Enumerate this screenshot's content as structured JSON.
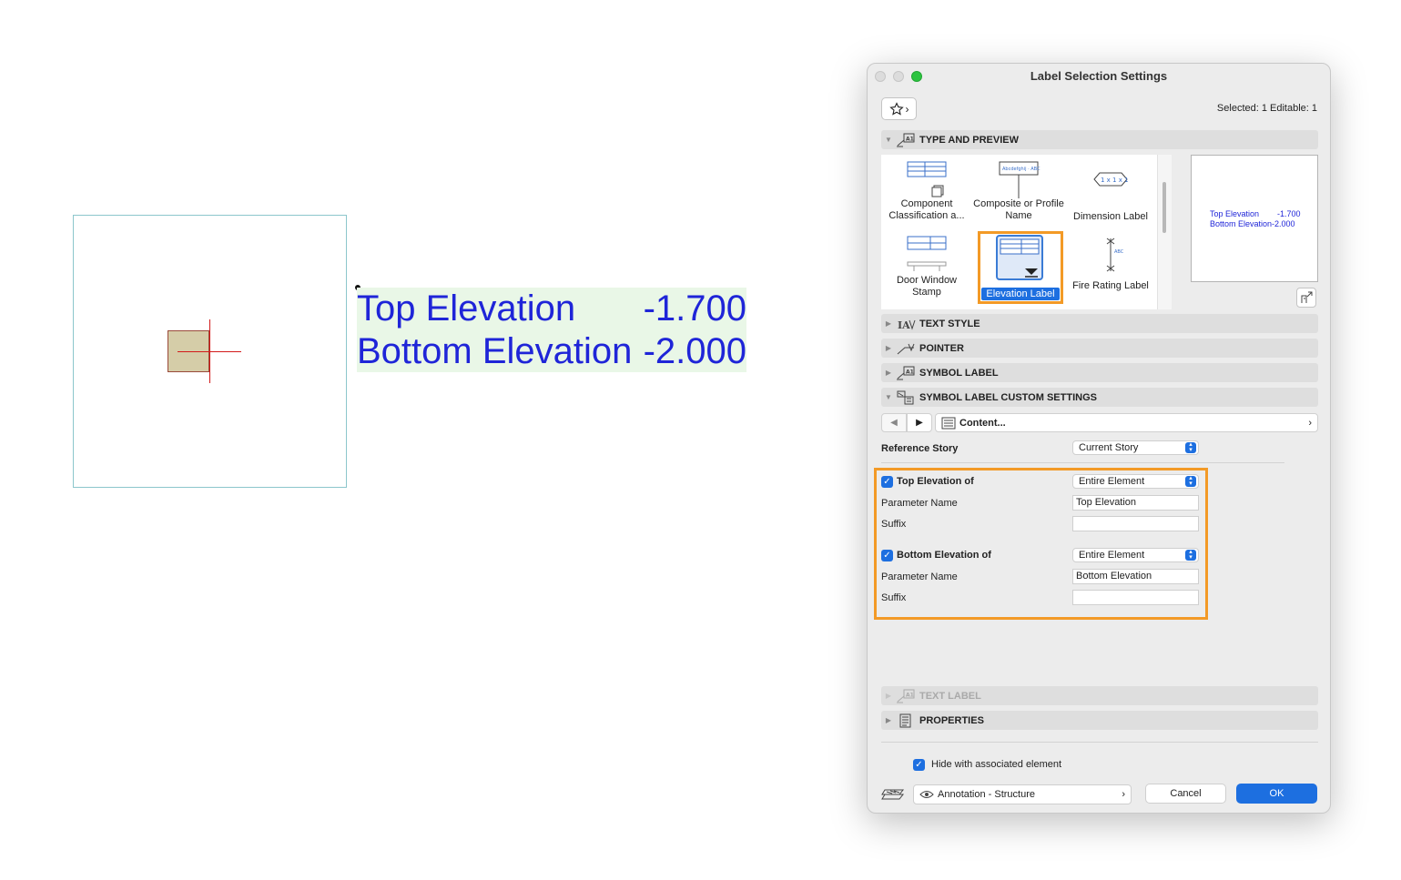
{
  "canvas": {
    "label_rows": [
      {
        "name": "Top Elevation",
        "value": "-1.700"
      },
      {
        "name": "Bottom Elevation",
        "value": "-2.000"
      }
    ]
  },
  "dialog": {
    "title": "Label Selection Settings",
    "selected_info": "Selected: 1 Editable: 1",
    "sections": {
      "type_and_preview": "TYPE AND PREVIEW",
      "text_style": "TEXT STYLE",
      "pointer": "POINTER",
      "symbol_label": "SYMBOL LABEL",
      "symbol_label_custom": "SYMBOL LABEL CUSTOM SETTINGS",
      "text_label": "TEXT LABEL",
      "properties": "PROPERTIES"
    },
    "label_types": [
      {
        "label": "Component Classification a..."
      },
      {
        "label": "Composite or Profile Name"
      },
      {
        "label": "Dimension Label"
      },
      {
        "label": "Door Window Stamp"
      },
      {
        "label": "Elevation Label",
        "selected": true
      },
      {
        "label": "Fire Rating Label"
      }
    ],
    "preview": {
      "rows": [
        {
          "name": "Top Elevation",
          "value": "-1.700"
        },
        {
          "name": "Bottom Elevation",
          "value": "-2.000"
        }
      ]
    },
    "content_nav": {
      "label": "Content..."
    },
    "reference_story": {
      "label": "Reference Story",
      "value": "Current Story"
    },
    "top_elevation": {
      "checkbox_label": "Top Elevation of",
      "checked": true,
      "scope": "Entire Element",
      "param_label": "Parameter Name",
      "param_value": "Top Elevation",
      "suffix_label": "Suffix",
      "suffix_value": ""
    },
    "bottom_elevation": {
      "checkbox_label": "Bottom Elevation of",
      "checked": true,
      "scope": "Entire Element",
      "param_label": "Parameter Name",
      "param_value": "Bottom Elevation",
      "suffix_label": "Suffix",
      "suffix_value": ""
    },
    "hide_with_element": {
      "label": "Hide with associated element",
      "checked": true
    },
    "layer": {
      "value": "Annotation - Structure"
    },
    "buttons": {
      "cancel": "Cancel",
      "ok": "OK"
    },
    "colors": {
      "accent": "#1d6fe0",
      "highlight": "#f39a26",
      "label_text": "#1f25d8"
    }
  }
}
